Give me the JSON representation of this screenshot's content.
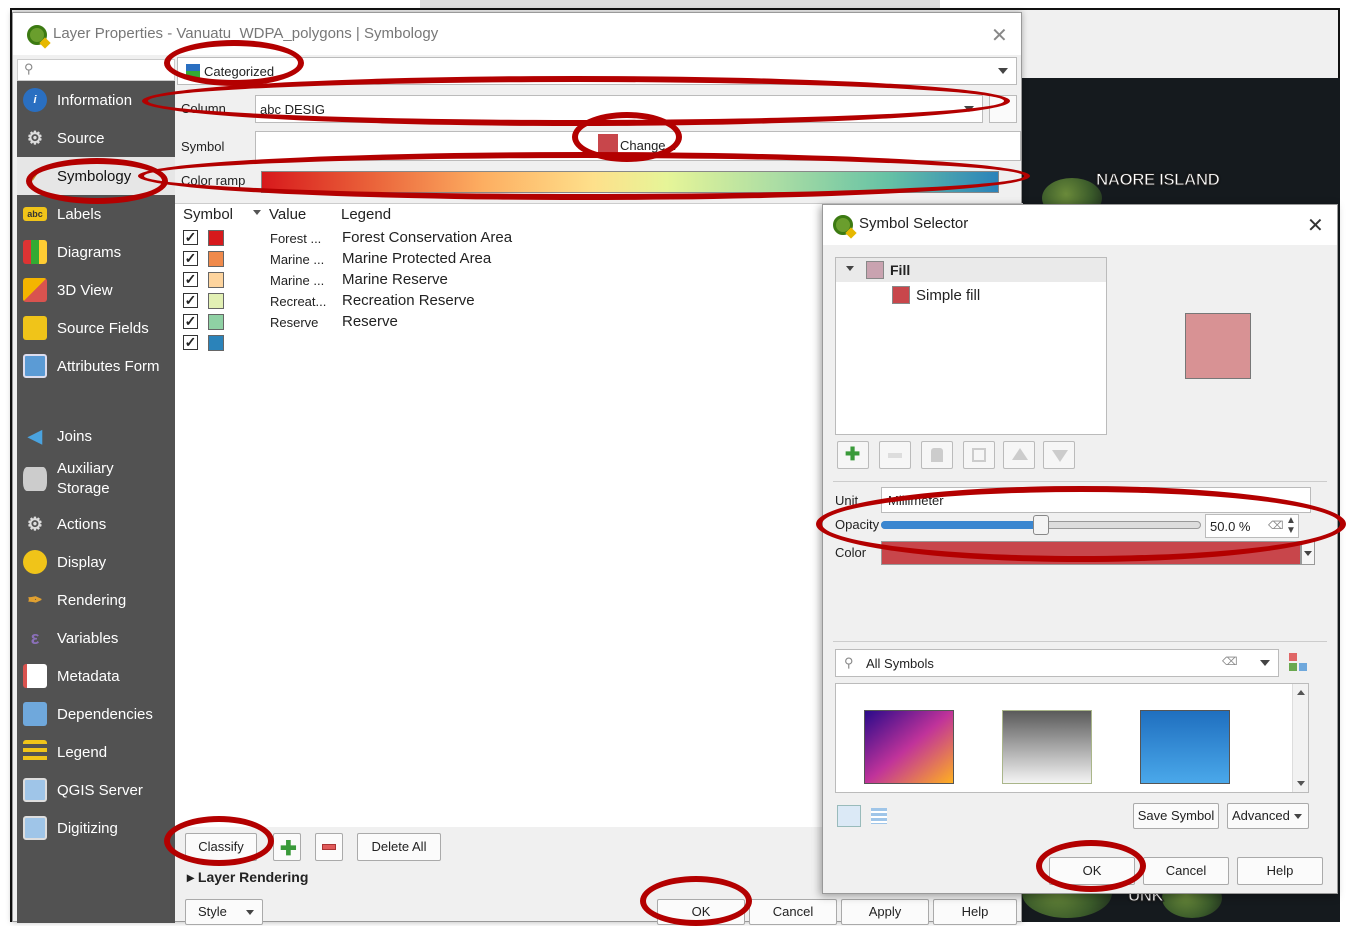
{
  "dialog": {
    "title": "Layer Properties - Vanuatu_WDPA_polygons | Symbology",
    "close_symbol": "✕"
  },
  "sidebar": {
    "items": [
      {
        "label": "Information",
        "icon": "info-icon"
      },
      {
        "label": "Source",
        "icon": "source-icon"
      },
      {
        "label": "Symbology",
        "icon": "paintbrush-icon"
      },
      {
        "label": "Labels",
        "icon": "labels-icon"
      },
      {
        "label": "Diagrams",
        "icon": "diagrams-icon"
      },
      {
        "label": "3D View",
        "icon": "cube-icon"
      },
      {
        "label": "Source Fields",
        "icon": "fields-icon"
      },
      {
        "label": "Attributes Form",
        "icon": "form-icon"
      },
      {
        "label": "Joins",
        "icon": "joins-icon"
      },
      {
        "label": "Auxiliary Storage",
        "icon": "storage-icon"
      },
      {
        "label": "Actions",
        "icon": "actions-icon"
      },
      {
        "label": "Display",
        "icon": "display-icon"
      },
      {
        "label": "Rendering",
        "icon": "rendering-icon"
      },
      {
        "label": "Variables",
        "icon": "variables-icon"
      },
      {
        "label": "Metadata",
        "icon": "metadata-icon"
      },
      {
        "label": "Dependencies",
        "icon": "dependencies-icon"
      },
      {
        "label": "Legend",
        "icon": "legend-icon"
      },
      {
        "label": "QGIS Server",
        "icon": "server-icon"
      },
      {
        "label": "Digitizing",
        "icon": "digitizing-icon"
      }
    ]
  },
  "symbology": {
    "renderer": "Categorized",
    "column_label": "Column",
    "column_value": "abc DESIG",
    "symbol_label": "Symbol",
    "change_label": "Change...",
    "color_ramp_label": "Color ramp",
    "table_headers": {
      "symbol": "Symbol",
      "value": "Value",
      "legend": "Legend"
    },
    "rows": [
      {
        "value": "Forest ...",
        "legend": "Forest Conservation Area",
        "color": "#d7191c"
      },
      {
        "value": "Marine ...",
        "legend": "Marine Protected Area",
        "color": "#f08a4b"
      },
      {
        "value": "Marine ...",
        "legend": "Marine Reserve",
        "color": "#fdd49e"
      },
      {
        "value": "Recreat...",
        "legend": "Recreation Reserve",
        "color": "#e2f0b4"
      },
      {
        "value": "Reserve",
        "legend": "Reserve",
        "color": "#8fd1a4"
      },
      {
        "value": "",
        "legend": "",
        "color": "#2b83ba"
      }
    ],
    "classify_label": "Classify",
    "delete_all_label": "Delete All",
    "layer_rendering_label": "Layer Rendering",
    "style_label": "Style",
    "ok_label": "OK",
    "cancel_label": "Cancel",
    "apply_label": "Apply",
    "help_label": "Help"
  },
  "symbol_selector": {
    "title": "Symbol Selector",
    "close_symbol": "✕",
    "tree_fill": "Fill",
    "tree_simple_fill": "Simple fill",
    "unit_label": "Unit",
    "unit_value": "Millimeter",
    "opacity_label": "Opacity",
    "opacity_value": "50.0 %",
    "opacity_fraction": 0.5,
    "color_label": "Color",
    "color_value": "#c8464b",
    "search_placeholder": "All Symbols",
    "save_symbol_label": "Save Symbol",
    "advanced_label": "Advanced",
    "ok_label": "OK",
    "cancel_label": "Cancel",
    "help_label": "Help"
  },
  "map": {
    "labels": [
      "NAORE ISLAND",
      "UNK"
    ]
  }
}
